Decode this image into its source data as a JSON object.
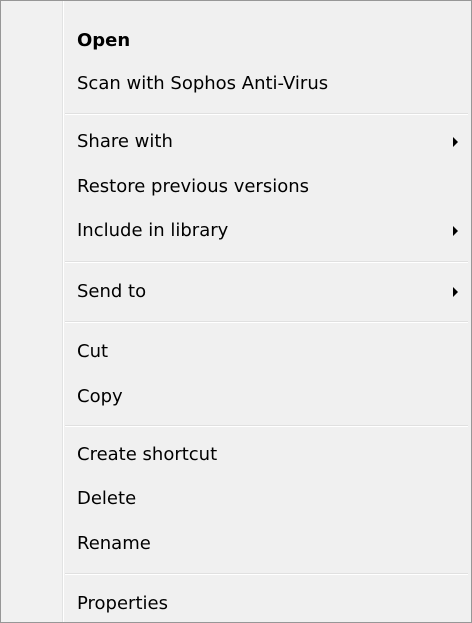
{
  "context_menu": {
    "items": [
      {
        "label": "Open"
      },
      {
        "label": "Scan with Sophos Anti-Virus"
      },
      {
        "label": "Share with"
      },
      {
        "label": "Restore previous versions"
      },
      {
        "label": "Include in library"
      },
      {
        "label": "Send to"
      },
      {
        "label": "Cut"
      },
      {
        "label": "Copy"
      },
      {
        "label": "Create shortcut"
      },
      {
        "label": "Delete"
      },
      {
        "label": "Rename"
      },
      {
        "label": "Properties"
      }
    ]
  },
  "colors": {
    "background": "#f0f0f0",
    "border": "#979797",
    "separator": "#e0e0e0",
    "text": "#000000"
  }
}
